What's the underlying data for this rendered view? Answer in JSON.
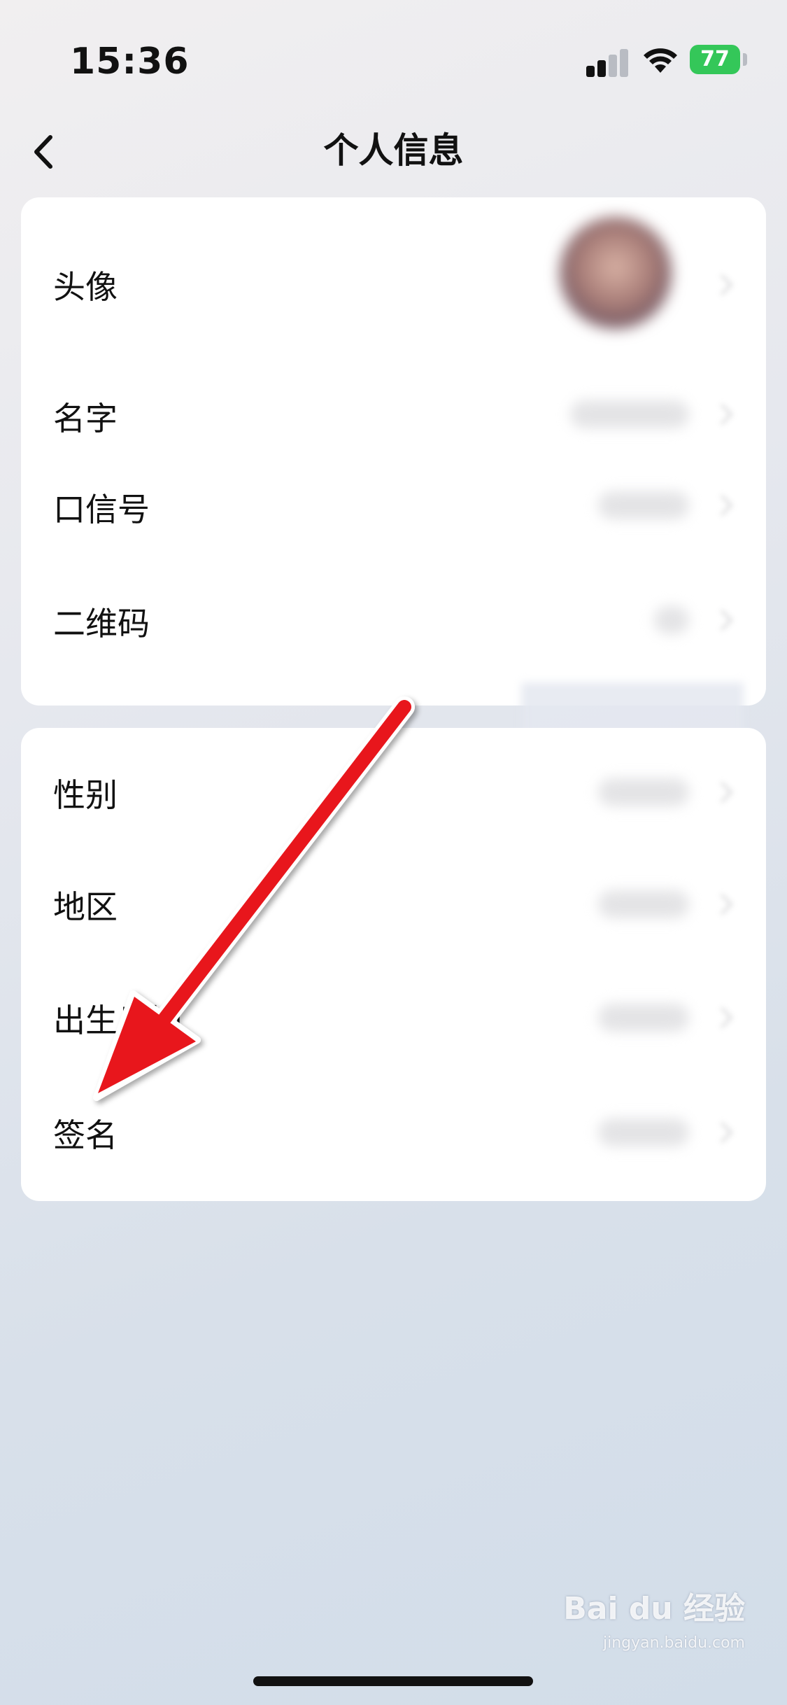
{
  "status_bar": {
    "time": "15:36",
    "battery": "77"
  },
  "nav": {
    "title": "个人信息"
  },
  "section1": {
    "rows": [
      {
        "label": "头像"
      },
      {
        "label": "名字"
      },
      {
        "label": "口信号"
      },
      {
        "label": "二维码"
      }
    ]
  },
  "section2": {
    "rows": [
      {
        "label": "性别"
      },
      {
        "label": "地区"
      },
      {
        "label": "出生日期"
      },
      {
        "label": "签名"
      }
    ]
  },
  "watermark": {
    "text": "Bai du 经验",
    "sub": "jingyan.baidu.com"
  },
  "colors": {
    "annotation_arrow": "#e8161b",
    "battery": "#34c759"
  }
}
